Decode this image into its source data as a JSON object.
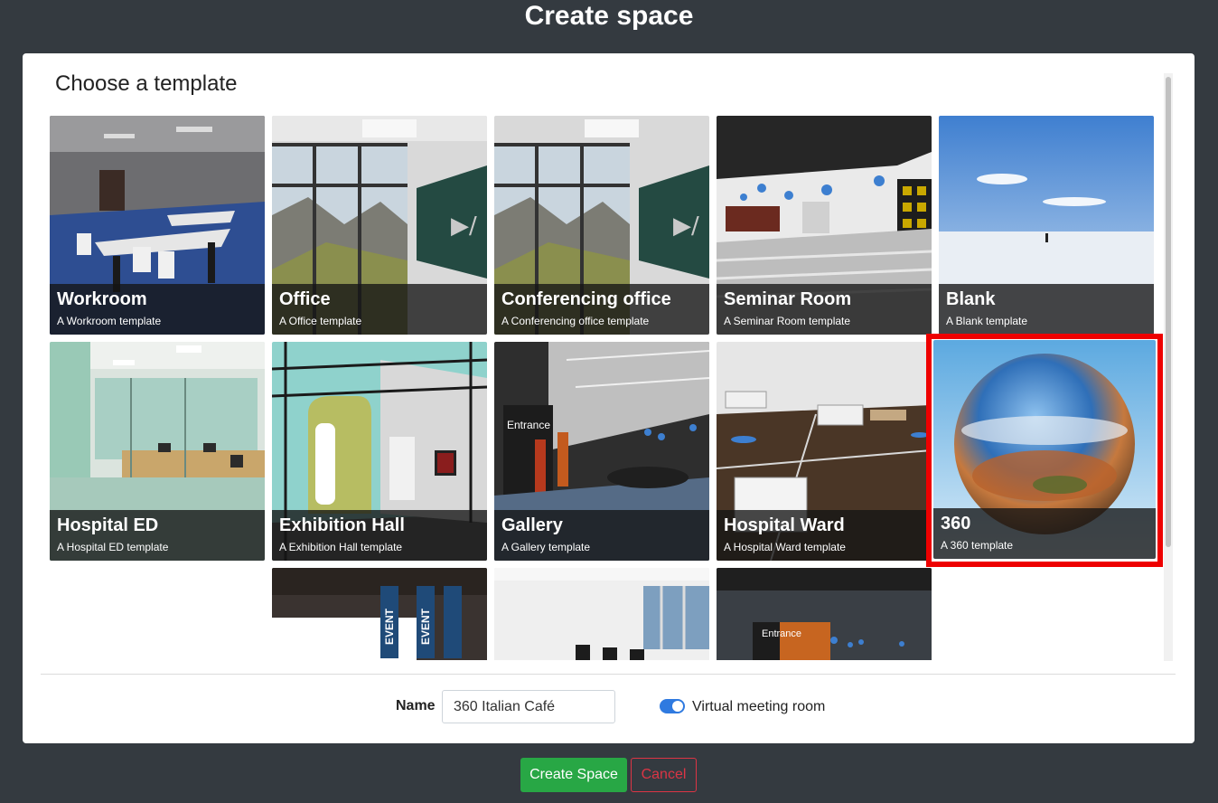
{
  "header": {
    "title": "Create space"
  },
  "panel": {
    "section_title": "Choose a template"
  },
  "templates": [
    {
      "title": "Workroom",
      "subtitle": "A Workroom template"
    },
    {
      "title": "Office",
      "subtitle": "A Office template"
    },
    {
      "title": "Conferencing office",
      "subtitle": "A Conferencing office template"
    },
    {
      "title": "Seminar Room",
      "subtitle": "A Seminar Room template"
    },
    {
      "title": "Blank",
      "subtitle": "A Blank template"
    },
    {
      "title": "Hospital ED",
      "subtitle": "A Hospital ED template"
    },
    {
      "title": "Exhibition Hall",
      "subtitle": "A Exhibition Hall template"
    },
    {
      "title": "Gallery",
      "subtitle": "A Gallery template"
    },
    {
      "title": "Hospital Ward",
      "subtitle": "A Hospital Ward template"
    },
    {
      "title": "360",
      "subtitle": "A 360 template",
      "selected": true
    }
  ],
  "partial_templates": {
    "event_banner_1": "EVENT",
    "event_banner_2": "EVENT",
    "entrance_sign": "Entrance",
    "gallery_entrance_sign": "Entrance"
  },
  "form": {
    "name_label": "Name",
    "name_value": "360 Italian Café",
    "virtual_meeting_label": "Virtual meeting room",
    "virtual_meeting_enabled": true
  },
  "buttons": {
    "create": "Create Space",
    "cancel": "Cancel"
  },
  "colors": {
    "background": "#343a40",
    "selection": "#ee0000",
    "create": "#28a745",
    "cancel": "#dc3545",
    "toggle": "#2f7ae0"
  }
}
